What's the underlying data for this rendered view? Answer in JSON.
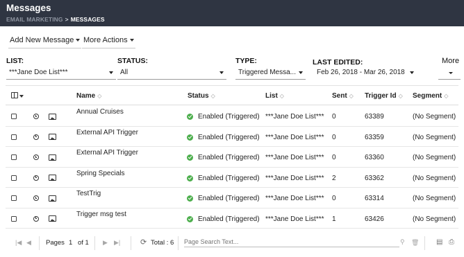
{
  "header": {
    "title": "Messages",
    "breadcrumb_parent": "EMAIL MARKETING",
    "breadcrumb_separator": ">",
    "breadcrumb_current": "MESSAGES",
    "background_color": "#2f3542"
  },
  "actions": {
    "add_new": "Add New Message",
    "more_actions": "More Actions"
  },
  "filters": {
    "list_label": "LIST:",
    "list_value": "***Jane Doe List***",
    "status_label": "STATUS:",
    "status_value": "All",
    "type_label": "TYPE:",
    "type_value": "Triggered Messa...",
    "last_edited_label": "LAST EDITED:",
    "last_edited_value": "Feb 26, 2018 - Mar 26, 2018",
    "more_label": "More"
  },
  "table": {
    "columns": {
      "name": "Name",
      "status": "Status",
      "list": "List",
      "sent": "Sent",
      "trigger_id": "Trigger Id",
      "segment": "Segment"
    },
    "rows": [
      {
        "name": "Annual Cruises",
        "status": "Enabled (Triggered)",
        "list": "***Jane Doe List***",
        "sent": "0",
        "trigger_id": "63389",
        "segment": "(No Segment)"
      },
      {
        "name": "External API Trigger",
        "status": "Enabled (Triggered)",
        "list": "***Jane Doe List***",
        "sent": "0",
        "trigger_id": "63359",
        "segment": "(No Segment)"
      },
      {
        "name": "External API Trigger",
        "status": "Enabled (Triggered)",
        "list": "***Jane Doe List***",
        "sent": "0",
        "trigger_id": "63360",
        "segment": "(No Segment)"
      },
      {
        "name": "Spring Specials",
        "status": "Enabled (Triggered)",
        "list": "***Jane Doe List***",
        "sent": "2",
        "trigger_id": "63362",
        "segment": "(No Segment)"
      },
      {
        "name": "TestTrig",
        "status": "Enabled (Triggered)",
        "list": "***Jane Doe List***",
        "sent": "0",
        "trigger_id": "63314",
        "segment": "(No Segment)"
      },
      {
        "name": "Trigger msg test",
        "status": "Enabled (Triggered)",
        "list": "***Jane Doe List***",
        "sent": "1",
        "trigger_id": "63426",
        "segment": "(No Segment)"
      }
    ],
    "status_color": "#4cae4c"
  },
  "footer": {
    "pages_label": "Pages",
    "page_current": "1",
    "page_of": "of 1",
    "total_label": "Total : 6",
    "search_placeholder": "Page Search Text..."
  }
}
